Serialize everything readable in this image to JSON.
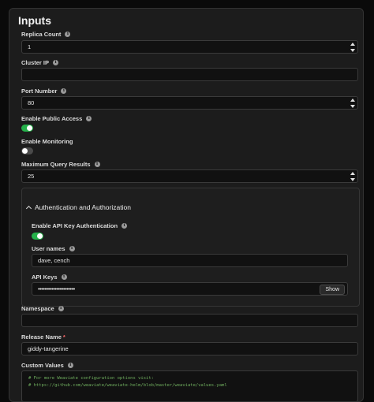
{
  "panel": {
    "title": "Inputs"
  },
  "fields": {
    "replica_count": {
      "label": "Replica Count",
      "value": "1"
    },
    "cluster_ip": {
      "label": "Cluster IP",
      "value": ""
    },
    "port_number": {
      "label": "Port Number",
      "value": "80"
    },
    "enable_public_access": {
      "label": "Enable Public Access",
      "checked": true
    },
    "enable_monitoring": {
      "label": "Enable Monitoring",
      "checked": false
    },
    "max_query_results": {
      "label": "Maximum Query Results",
      "value": "25"
    },
    "auth_group": {
      "header": "Authentication and Authorization",
      "enable_api_key": {
        "label": "Enable API Key Authentication",
        "checked": true
      },
      "user_names": {
        "label": "User names",
        "value": "dave, cench"
      },
      "api_keys": {
        "label": "API Keys",
        "value": "••••••••••••••••••••••",
        "show_label": "Show"
      }
    },
    "namespace": {
      "label": "Namespace",
      "value": ""
    },
    "release_name": {
      "label": "Release Name",
      "required_mark": "*",
      "value": "giddy-tangerine"
    },
    "custom_values": {
      "label": "Custom Values",
      "lines": [
        "# For more Weaviate configuration options visit:",
        "# https://github.com/weaviate/weaviate-helm/blob/master/weaviate/values.yaml"
      ]
    }
  },
  "icons": {
    "info": "info-icon",
    "collapse": "chevron-up-icon"
  },
  "colors": {
    "toggle_on": "#25b14a",
    "toggle_off": "#4a4a4a",
    "code_comment": "#6fae5e"
  }
}
